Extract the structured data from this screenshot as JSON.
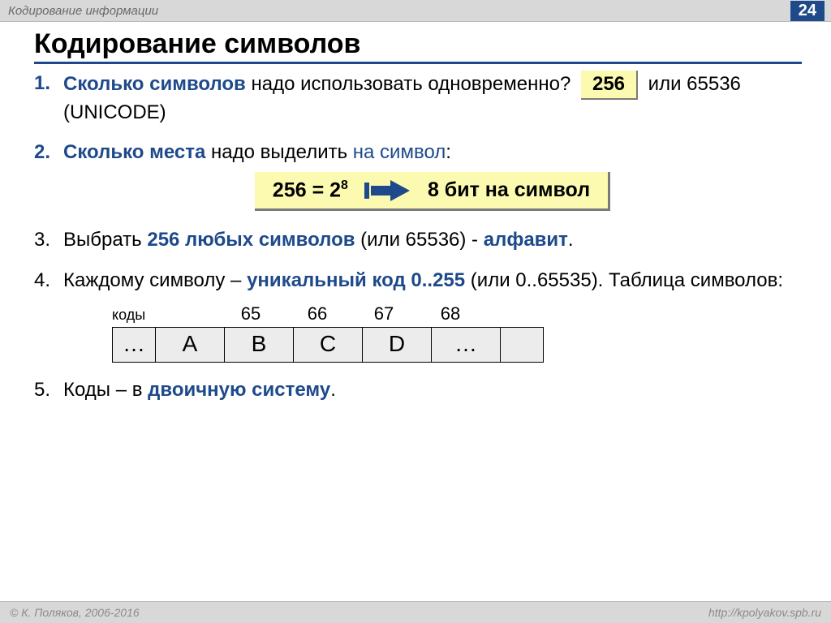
{
  "header": {
    "title": "Кодирование информации",
    "page": "24"
  },
  "title": "Кодирование символов",
  "items": {
    "n1": "1.",
    "i1_a": "Сколько символов",
    "i1_b": " надо использовать одновременно?   ",
    "i1_box": "256",
    "i1_c": "  или 65536 (UNICODE)",
    "n2": "2.",
    "i2_a": "Сколько места",
    "i2_b": " надо выделить ",
    "i2_c": "на символ",
    "i2_d": ":",
    "formula_l": "256 = 2",
    "formula_exp": "8",
    "formula_r": "8 бит на символ",
    "n3": "3.",
    "i3_a": "Выбрать ",
    "i3_b": "256 любых символов",
    "i3_c": " (или 65536) - ",
    "i3_d": "алфавит",
    "i3_e": ".",
    "n4": "4.",
    "i4_a": "Каждому символу – ",
    "i4_b": "уникальный код 0..255",
    "i4_c": " (или 0..65535). Таблица символов:",
    "codes_label": "коды",
    "codes": [
      "65",
      "66",
      "67",
      "68"
    ],
    "chars": [
      "…",
      "A",
      "B",
      "C",
      "D",
      "…",
      ""
    ],
    "n5": "5.",
    "i5_a": "Коды – в ",
    "i5_b": "двоичную систему",
    "i5_c": "."
  },
  "footer": {
    "left": "© К. Поляков, 2006-2016",
    "right": "http://kpolyakov.spb.ru"
  }
}
